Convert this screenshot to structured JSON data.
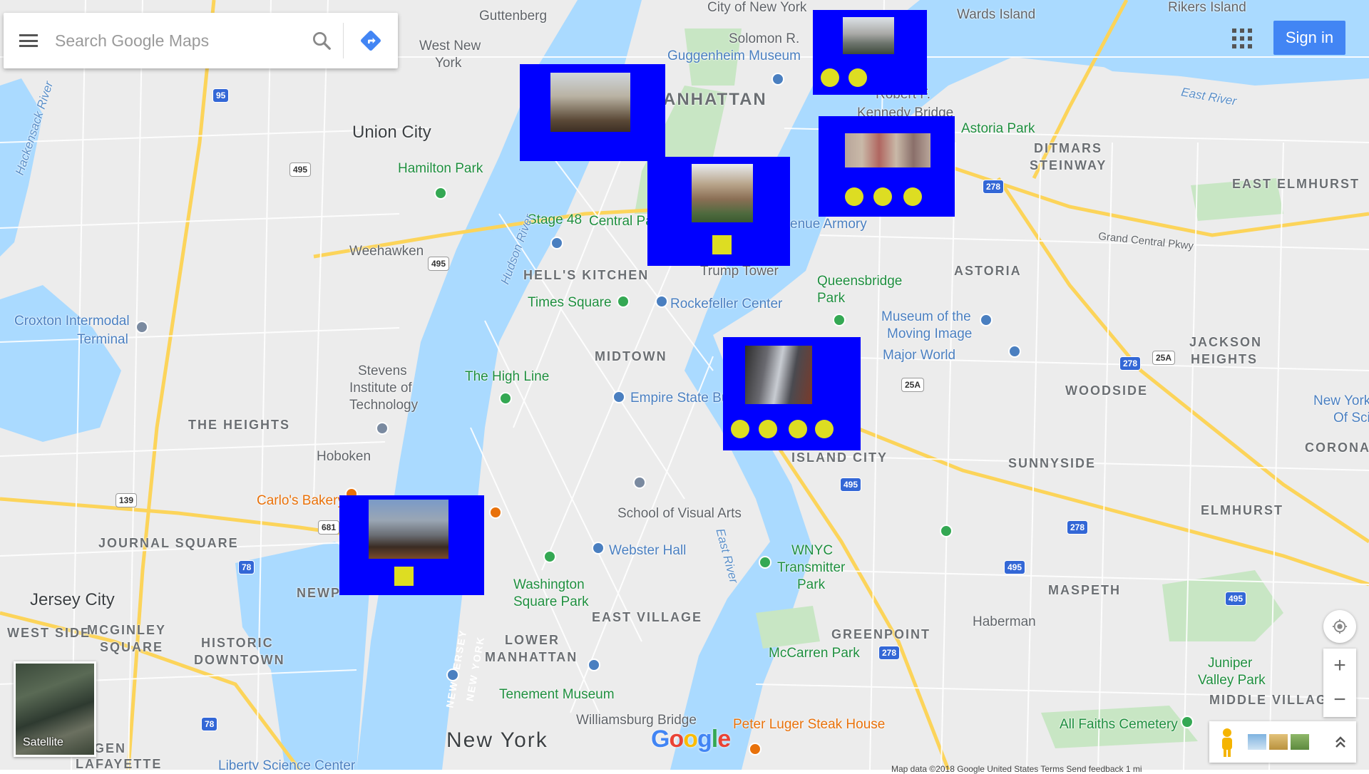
{
  "search": {
    "placeholder": "Search Google Maps"
  },
  "header": {
    "sign_in": "Sign in"
  },
  "satellite_label": "Satellite",
  "google_logo": "Google",
  "footer": "Map data ©2018 Google   United States   Terms   Send feedback   1 mi",
  "labels": {
    "guttenberg": "Guttenberg",
    "city_of_new_york": "City of New York",
    "wards_island": "Wards Island",
    "rikers_island": "Rikers Island",
    "west_new_york_1": "West New",
    "west_new_york_2": "York",
    "solomon": "Solomon R.",
    "guggenheim": "Guggenheim Museum",
    "manhattan": "ANHATTAN",
    "union_city": "Union City",
    "hamilton_park": "Hamilton Park",
    "astoria_park": "Astoria Park",
    "ditmars": "DITMARS",
    "steinway": "STEINWAY",
    "east_elmhurst": "EAST ELMHURST",
    "grand_central_pkwy": "Grand Central Pkwy",
    "east_river_top": "East River",
    "stage48": "Stage 48",
    "central_park": "Central Pa",
    "hudson_river": "Hudson River",
    "weehawken": "Weehawken",
    "hells_kitchen": "HELL'S KITCHEN",
    "trump_tower": "Trump Tower",
    "queensbridge_1": "Queensbridge",
    "queensbridge_2": "Park",
    "astoria": "ASTORIA",
    "times_square": "Times Square",
    "rockefeller": "Rockefeller Center",
    "croxton_1": "Croxton Intermodal",
    "croxton_2": "Terminal",
    "museum_moving_1": "Museum of the",
    "museum_moving_2": "Moving Image",
    "major_world": "Major World",
    "jackson_1": "JACKSON",
    "jackson_2": "HEIGHTS",
    "stevens_1": "Stevens",
    "stevens_2": "Institute of",
    "stevens_3": "Technology",
    "midtown": "MIDTOWN",
    "high_line": "The High Line",
    "empire": "Empire State Bu",
    "the_heights": "THE HEIGHTS",
    "woodside": "WOODSIDE",
    "new_york_sci_1": "New York",
    "new_york_sci_2": "Of Sci",
    "hoboken": "Hoboken",
    "island_city": "ISLAND CITY",
    "sunnyside": "SUNNYSIDE",
    "corona": "CORONA",
    "carlos": "Carlo's Bakery",
    "school_visual": "School of Visual Arts",
    "elmhurst": "ELMHURST",
    "journal_square": "JOURNAL SQUARE",
    "webster": "Webster Hall",
    "wnyc_1": "WNYC",
    "wnyc_2": "Transmitter",
    "wnyc_3": "Park",
    "maspeth": "MASPETH",
    "newport": "NEWP",
    "washington_1": "Washington",
    "washington_2": "Square Park",
    "jersey_city": "Jersey City",
    "east_village": "EAST VILLAGE",
    "haberman": "Haberman",
    "west_side": "WEST SIDE",
    "mcginley_1": "MCGINLEY",
    "mcginley_2": "SQUARE",
    "historic_1": "HISTORIC",
    "historic_2": "DOWNTOWN",
    "lower_1": "LOWER",
    "lower_2": "MANHATTAN",
    "greenpoint": "GREENPOINT",
    "mccarren": "McCarren Park",
    "juniper_1": "Juniper",
    "juniper_2": "Valley Park",
    "middle_village": "MIDDLE VILLAG",
    "tenement": "Tenement Museum",
    "williamsburg": "Williamsburg Bridge",
    "peter_luger": "Peter Luger Steak House",
    "all_faiths": "All Faiths Cemetery",
    "new_york": "New York",
    "gen": "GEN",
    "lafayette": "LAFAYETTE",
    "liberty_science": "Liberty Science Center",
    "robert_f": "Robert F.",
    "kennedy_bridge": "Kennedy Bridge",
    "avenue_armory": "enue Armory",
    "hackensack": "Hackensack River",
    "east_river_mid": "East River",
    "new_jersey": "NEW JERSEY",
    "new_york_state": "NEW YORK"
  },
  "cards": [
    {
      "id": "card-1",
      "dots": 0,
      "squares": 0,
      "photo": "building-facade"
    },
    {
      "id": "card-2",
      "dots": 2,
      "squares": 0,
      "photo": "museum-facade"
    },
    {
      "id": "card-3",
      "dots": 0,
      "squares": 1,
      "photo": "mansion"
    },
    {
      "id": "card-4",
      "dots": 3,
      "squares": 0,
      "photo": "met-museum"
    },
    {
      "id": "card-5",
      "dots": 4,
      "squares": 0,
      "photo": "skyscrapers"
    },
    {
      "id": "card-6",
      "dots": 0,
      "squares": 1,
      "photo": "whitney-museum"
    }
  ],
  "colors": {
    "water": "#aadaff",
    "land": "#ececec",
    "park": "#c8e6c4",
    "highway": "#fcd45a",
    "card_bg": "#0000ff",
    "marker": "#dddd22",
    "accent": "#4285f4"
  },
  "icons": [
    "menu-icon",
    "search-icon",
    "directions-icon",
    "apps-icon",
    "location-icon",
    "pegman-icon",
    "expand-icon"
  ]
}
